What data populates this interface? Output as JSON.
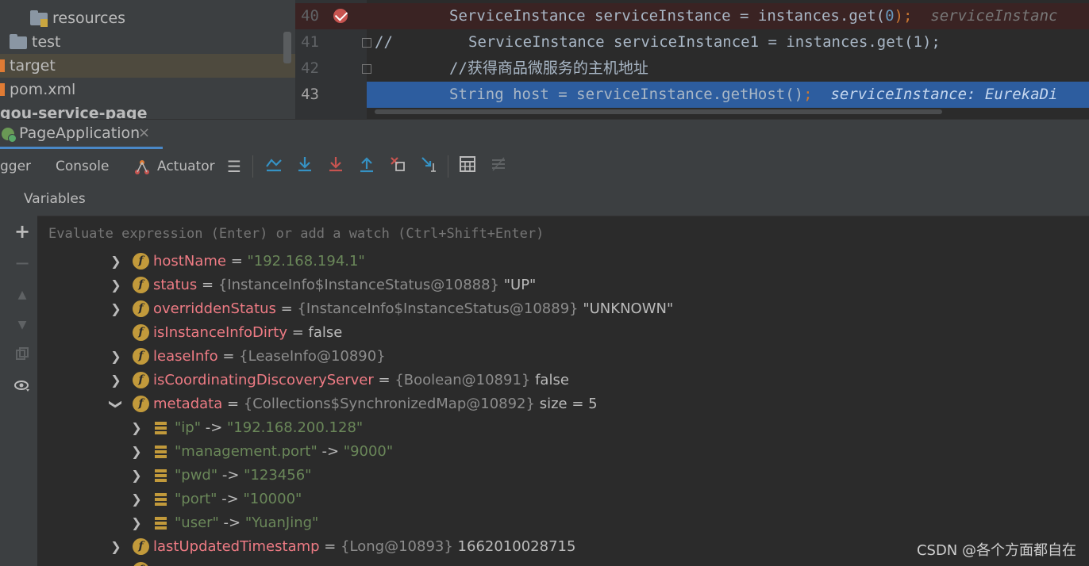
{
  "project_tree": {
    "items": [
      {
        "label": "resources",
        "icon": "resources-folder-icon"
      },
      {
        "label": "test",
        "icon": "folder-icon"
      },
      {
        "label": "target",
        "icon": "excluded-folder-icon"
      },
      {
        "label": "pom.xml",
        "icon": "maven-file-icon"
      },
      {
        "label": "gou-service-page",
        "icon": "module-icon"
      }
    ]
  },
  "editor": {
    "lines": [
      {
        "number": "40",
        "code": "ServiceInstance serviceInstance = instances.get(",
        "arg": "0",
        "tail": ");",
        "inline": "serviceInstanc"
      },
      {
        "number": "41",
        "prefix": "//",
        "code": "ServiceInstance serviceInstance1 = instances.get(1);"
      },
      {
        "number": "42",
        "code": "//获得商品微服务的主机地址"
      },
      {
        "number": "43",
        "code": "String host = serviceInstance.getHost()",
        "tail": ";",
        "inline": "serviceInstance: EurekaDi"
      }
    ]
  },
  "debug": {
    "run_tab_label": "PageApplication",
    "run_tab_close": "×",
    "tabs": {
      "debugger": "gger",
      "console": "Console",
      "actuator": "Actuator"
    },
    "variables_title": "Variables",
    "watch_placeholder": "Evaluate expression (Enter) or add a watch (Ctrl+Shift+Enter)"
  },
  "variables": [
    {
      "name": "hostName",
      "eq": " = ",
      "type": "",
      "value": "\"192.168.194.1\"",
      "value_style": "string",
      "expandable": true,
      "expanded": false
    },
    {
      "name": "status",
      "eq": " = ",
      "type": "{InstanceInfo$InstanceStatus@10888}",
      "value": " \"UP\"",
      "value_style": "plain",
      "expandable": true,
      "expanded": false
    },
    {
      "name": "overriddenStatus",
      "eq": " = ",
      "type": "{InstanceInfo$InstanceStatus@10889}",
      "value": " \"UNKNOWN\"",
      "value_style": "plain",
      "expandable": true,
      "expanded": false
    },
    {
      "name": "isInstanceInfoDirty",
      "eq": " = ",
      "type": "",
      "value": "false",
      "value_style": "plain",
      "expandable": false,
      "expanded": false
    },
    {
      "name": "leaseInfo",
      "eq": " = ",
      "type": "{LeaseInfo@10890}",
      "value": "",
      "value_style": "plain",
      "expandable": true,
      "expanded": false
    },
    {
      "name": "isCoordinatingDiscoveryServer",
      "eq": " = ",
      "type": "{Boolean@10891}",
      "value": " false",
      "value_style": "plain",
      "expandable": true,
      "expanded": false
    },
    {
      "name": "metadata",
      "eq": " = ",
      "type": "{Collections$SynchronizedMap@10892}",
      "value": "  size = 5",
      "value_style": "plain",
      "expandable": true,
      "expanded": true
    }
  ],
  "metadata_entries": [
    {
      "key": "\"ip\"",
      "arrow": " -> ",
      "value": "\"192.168.200.128\""
    },
    {
      "key": "\"management.port\"",
      "arrow": " -> ",
      "value": "\"9000\""
    },
    {
      "key": "\"pwd\"",
      "arrow": " -> ",
      "value": "\"123456\""
    },
    {
      "key": "\"port\"",
      "arrow": " -> ",
      "value": "\"10000\""
    },
    {
      "key": "\"user\"",
      "arrow": " -> ",
      "value": "\"YuanJing\""
    }
  ],
  "last_var": {
    "name": "lastUpdatedTimestamp",
    "eq": " = ",
    "type": "{Long@10893}",
    "value": " 1662010028715"
  },
  "watermark": "CSDN @各个方面都自在",
  "colors": {
    "field_name": "#ee7b84",
    "string_value": "#6a8759",
    "field_icon": "#c29a3b",
    "current_line": "#2d5d9f",
    "breakpoint": "#c75450"
  }
}
